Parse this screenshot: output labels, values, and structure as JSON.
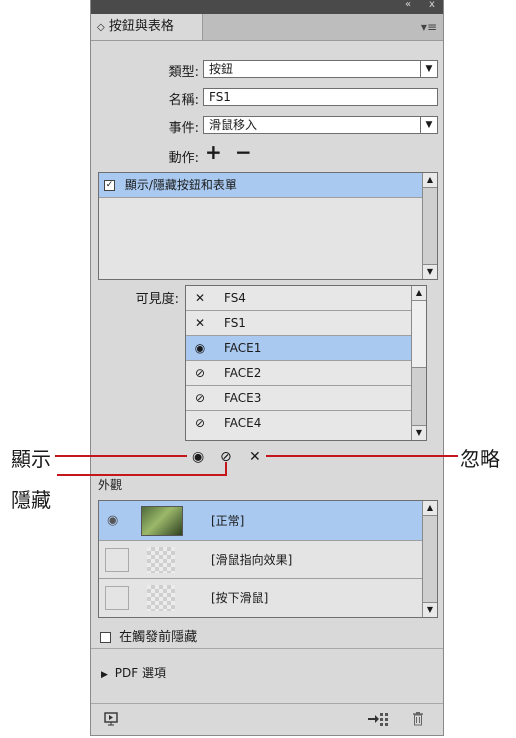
{
  "window": {
    "collapse_icon": "«",
    "close_icon": "x",
    "menu_icon": "▾≡"
  },
  "panel": {
    "tab_title": "按鈕與表格",
    "tab_glyph": "◇"
  },
  "form": {
    "type_label": "類型:",
    "type_value": "按鈕",
    "name_label": "名稱:",
    "name_value": "FS1",
    "event_label": "事件:",
    "event_value": "滑鼠移入",
    "action_label": "動作:",
    "add_glyph": "+",
    "remove_glyph": "−"
  },
  "actions_list": {
    "items": [
      {
        "label": "顯示/隱藏按鈕和表單",
        "checked": true
      }
    ]
  },
  "visibility": {
    "label": "可見度:",
    "items": [
      {
        "state": "ignore",
        "glyph": "✕",
        "name": "FS4"
      },
      {
        "state": "ignore",
        "glyph": "✕",
        "name": "FS1"
      },
      {
        "state": "show",
        "glyph": "◉",
        "name": "FACE1",
        "selected": true
      },
      {
        "state": "hide",
        "glyph": "⊘",
        "name": "FACE2"
      },
      {
        "state": "hide",
        "glyph": "⊘",
        "name": "FACE3"
      },
      {
        "state": "hide",
        "glyph": "⊘",
        "name": "FACE4"
      }
    ],
    "show_glyph": "◉",
    "hide_glyph": "⊘",
    "ignore_glyph": "✕"
  },
  "annotations": {
    "show": "顯示",
    "hide": "隱藏",
    "ignore": "忽略"
  },
  "appearance": {
    "label": "外觀",
    "states": [
      {
        "name": "[正常]",
        "selected": true
      },
      {
        "name": "[滑鼠指向效果]"
      },
      {
        "name": "[按下滑鼠]"
      }
    ]
  },
  "hide_until_triggered": {
    "label": "在觸發前隱藏"
  },
  "pdf_options": {
    "label": "PDF 選項"
  },
  "footer": {
    "preview_icon": "preview-icon",
    "convert_icon": "convert-icon",
    "trash_icon": "trash-icon"
  },
  "colors": {
    "selection": "#a9c9f0",
    "annotation_line": "#c4161c",
    "panel_bg": "#d9d9d9"
  }
}
